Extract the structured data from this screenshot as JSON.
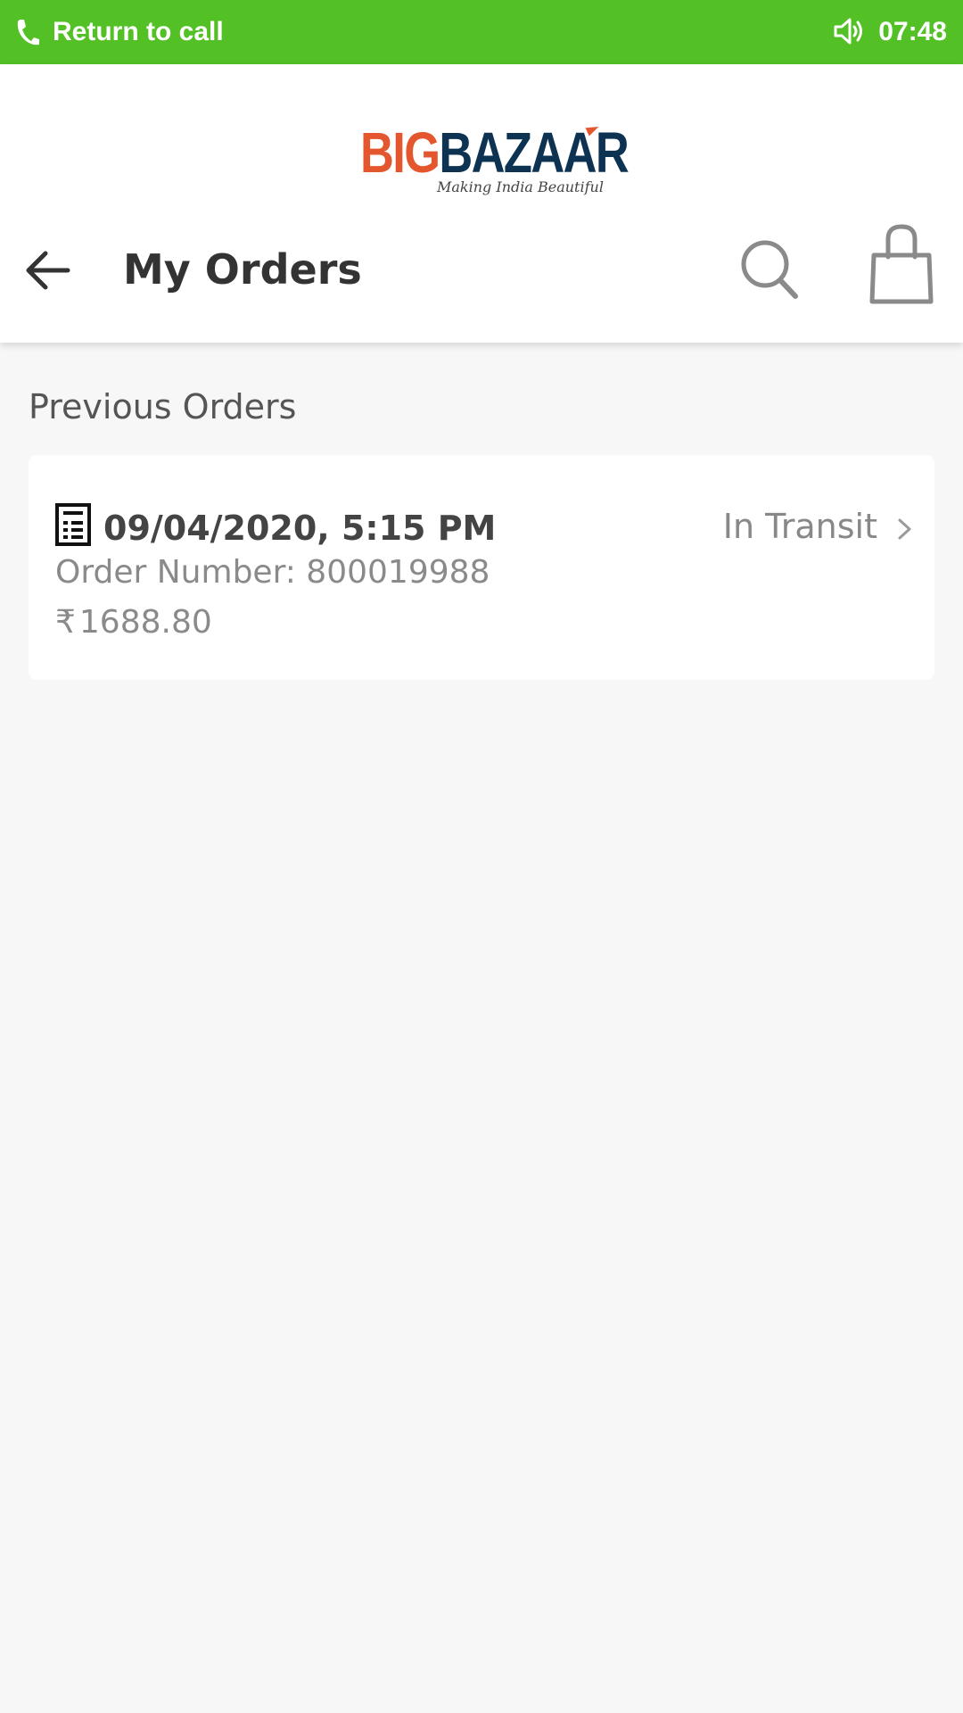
{
  "call_bar": {
    "label": "Return to call",
    "time": "07:48",
    "background": "#53c125",
    "icons": [
      "phone-icon",
      "speaker-icon"
    ]
  },
  "header": {
    "logo": {
      "brand_first": "BIG",
      "brand_second": "BAZAAR",
      "tagline": "Making India Beautiful",
      "colors": {
        "orange": "#e4572e",
        "navy": "#0d3252"
      }
    },
    "title": "My Orders",
    "icons": [
      "back-arrow-icon",
      "search-icon",
      "shopping-bag-icon"
    ]
  },
  "section": {
    "title": "Previous Orders"
  },
  "orders": [
    {
      "date": "09/04/2020, 5:15 PM",
      "status": "In Transit",
      "order_number": "Order Number: 800019988",
      "currency": "₹",
      "amount": "1688.80",
      "icons": [
        "receipt-icon",
        "chevron-right-icon"
      ]
    }
  ]
}
